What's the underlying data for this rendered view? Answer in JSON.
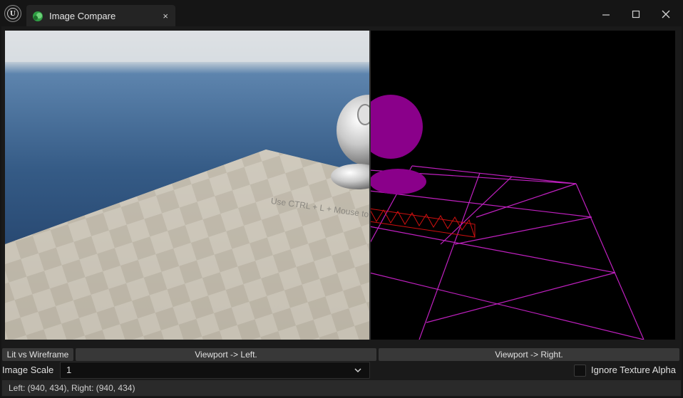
{
  "window": {
    "tab_title": "Image Compare",
    "tab_close_glyph": "×",
    "logo_glyph": "U"
  },
  "viewport": {
    "hint_text": "Use CTRL + L + Mouse to"
  },
  "buttons": {
    "lit_vs_wireframe": "Lit vs Wireframe",
    "viewport_left": "Viewport -> Left.",
    "viewport_right": "Viewport -> Right."
  },
  "image_scale": {
    "label": "Image Scale",
    "value": "1"
  },
  "ignore_texture_alpha": {
    "label": "Ignore Texture Alpha",
    "checked": false
  },
  "status": {
    "text": "Left: (940, 434), Right: (940, 434)"
  },
  "colors": {
    "wireframe_magenta": "#c020c0",
    "sphere_purple": "#8a008a",
    "wireframe_red": "#d01010",
    "sky_blue": "#3d6a9a",
    "floor_beige": "#c8c2b4"
  },
  "icons": {
    "app_logo": "unreal-logo-icon",
    "tab_icon": "image-compare-icon",
    "minimize": "minimize-icon",
    "maximize": "maximize-icon",
    "close": "close-icon",
    "chevron": "chevron-down-icon"
  }
}
